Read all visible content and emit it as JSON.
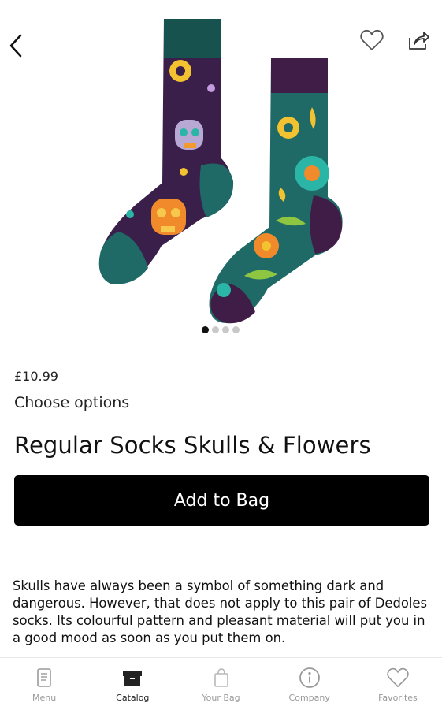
{
  "product": {
    "price": "£10.99",
    "options_label": "Choose options",
    "title": "Regular Socks Skulls & Flowers",
    "add_to_bag_label": "Add to Bag",
    "description": "Skulls have always been a symbol of something dark and dangerous. However, that does not apply to this pair of Dedoles socks. Its colourful pattern and pleasant material will put you in a good mood as soon as you put them on."
  },
  "gallery": {
    "image_count": 4,
    "active_index": 0
  },
  "header_icons": [
    "back-arrow-icon",
    "heart-icon",
    "share-icon"
  ],
  "tabbar": {
    "active": "Catalog",
    "items": [
      {
        "label": "Menu",
        "icon": "menu-book-icon"
      },
      {
        "label": "Catalog",
        "icon": "catalog-box-icon"
      },
      {
        "label": "Your Bag",
        "icon": "shopping-bag-icon"
      },
      {
        "label": "Company",
        "icon": "info-icon"
      },
      {
        "label": "Favorites",
        "icon": "heart-icon"
      }
    ]
  },
  "colors": {
    "sock_purple": "#3a1f4a",
    "sock_teal": "#1f6a66",
    "cuff_teal": "#17524f",
    "cuff_purple": "#3f1d47",
    "button": "#000000",
    "tab_inactive": "#9a9a9a"
  }
}
